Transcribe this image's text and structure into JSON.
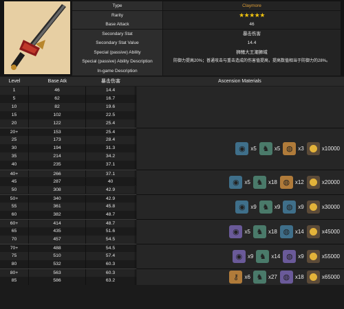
{
  "weapon": {
    "image_icon": "sword-icon",
    "stats": [
      {
        "label": "Type",
        "value": "Claymore",
        "style": "gold"
      },
      {
        "label": "Rarity",
        "value": "★★★★★",
        "style": "stars"
      },
      {
        "label": "Base Attack",
        "value": "46",
        "style": ""
      },
      {
        "label": "Secondary Stat",
        "value": "暴击伤害",
        "style": ""
      },
      {
        "label": "Secondary Stat Value",
        "value": "14.4",
        "style": ""
      },
      {
        "label": "Special (passive) Ability",
        "value": "狮鳍大王潮狮域",
        "style": ""
      },
      {
        "label": "Special (passive) Ability Description",
        "value": "防御力提高20%；普通攻击与重击造成的伤害值提高，提高数值相当于防御力的28%。",
        "style": "desc"
      },
      {
        "label": "In-game Description",
        "value": "",
        "style": ""
      }
    ]
  },
  "table": {
    "headers": [
      "Level",
      "Base Atk",
      "暴击伤害",
      "Ascension Materials"
    ],
    "rows": [
      [
        "1",
        "46",
        "14.4"
      ],
      [
        "5",
        "62",
        "16.7"
      ],
      [
        "10",
        "82",
        "19.6"
      ],
      [
        "15",
        "102",
        "22.5"
      ],
      [
        "20",
        "122",
        "25.4"
      ],
      [
        "20+",
        "153",
        "25.4"
      ],
      [
        "25",
        "173",
        "28.4"
      ],
      [
        "30",
        "194",
        "31.3"
      ],
      [
        "35",
        "214",
        "34.2"
      ],
      [
        "40",
        "235",
        "37.1"
      ],
      [
        "40+",
        "266",
        "37.1"
      ],
      [
        "45",
        "287",
        "40"
      ],
      [
        "50",
        "308",
        "42.9"
      ],
      [
        "50+",
        "340",
        "42.9"
      ],
      [
        "55",
        "361",
        "45.8"
      ],
      [
        "60",
        "382",
        "48.7"
      ],
      [
        "60+",
        "414",
        "48.7"
      ],
      [
        "65",
        "435",
        "51.6"
      ],
      [
        "70",
        "457",
        "54.5"
      ],
      [
        "70+",
        "488",
        "54.5"
      ],
      [
        "75",
        "510",
        "57.4"
      ],
      [
        "80",
        "532",
        "60.3"
      ],
      [
        "80+",
        "563",
        "60.3"
      ],
      [
        "85",
        "586",
        "63.2"
      ]
    ],
    "ascensions": [
      {
        "items": [
          {
            "icon": "conch-icon",
            "tier": "r3",
            "qty": "x5"
          },
          {
            "icon": "mob-drop-icon",
            "tier": "mob",
            "qty": "x5"
          },
          {
            "icon": "scroll-icon",
            "tier": "r5",
            "qty": "x3"
          },
          {
            "icon": "mora-icon",
            "tier": "mora",
            "qty": "x10000"
          }
        ]
      },
      {
        "items": [
          {
            "icon": "conch-icon",
            "tier": "r3",
            "qty": "x5"
          },
          {
            "icon": "mob-drop-icon",
            "tier": "mob",
            "qty": "x18"
          },
          {
            "icon": "scroll-icon",
            "tier": "r5",
            "qty": "x12"
          },
          {
            "icon": "mora-icon",
            "tier": "mora",
            "qty": "x20000"
          }
        ]
      },
      {
        "items": [
          {
            "icon": "conch-icon",
            "tier": "r3",
            "qty": "x9"
          },
          {
            "icon": "mob-drop-icon",
            "tier": "mob",
            "qty": "x9"
          },
          {
            "icon": "scroll-icon",
            "tier": "r3",
            "qty": "x9"
          },
          {
            "icon": "mora-icon",
            "tier": "mora",
            "qty": "x30000"
          }
        ]
      },
      {
        "items": [
          {
            "icon": "conch-icon",
            "tier": "r4",
            "qty": "x5"
          },
          {
            "icon": "mob-drop-icon",
            "tier": "mob",
            "qty": "x18"
          },
          {
            "icon": "scroll-icon",
            "tier": "r3",
            "qty": "x14"
          },
          {
            "icon": "mora-icon",
            "tier": "mora",
            "qty": "x45000"
          }
        ]
      },
      {
        "items": [
          {
            "icon": "conch-icon",
            "tier": "r4",
            "qty": "x9"
          },
          {
            "icon": "mob-drop-icon",
            "tier": "mob",
            "qty": "x14"
          },
          {
            "icon": "scroll-icon",
            "tier": "r4",
            "qty": "x9"
          },
          {
            "icon": "mora-icon",
            "tier": "mora",
            "qty": "x55000"
          }
        ]
      },
      {
        "items": [
          {
            "icon": "key-icon",
            "tier": "r5",
            "qty": "x6"
          },
          {
            "icon": "mob-drop-icon",
            "tier": "mob",
            "qty": "x27"
          },
          {
            "icon": "scroll-icon",
            "tier": "r4",
            "qty": "x18"
          },
          {
            "icon": "mora-icon",
            "tier": "mora",
            "qty": "x65000"
          }
        ]
      }
    ]
  }
}
